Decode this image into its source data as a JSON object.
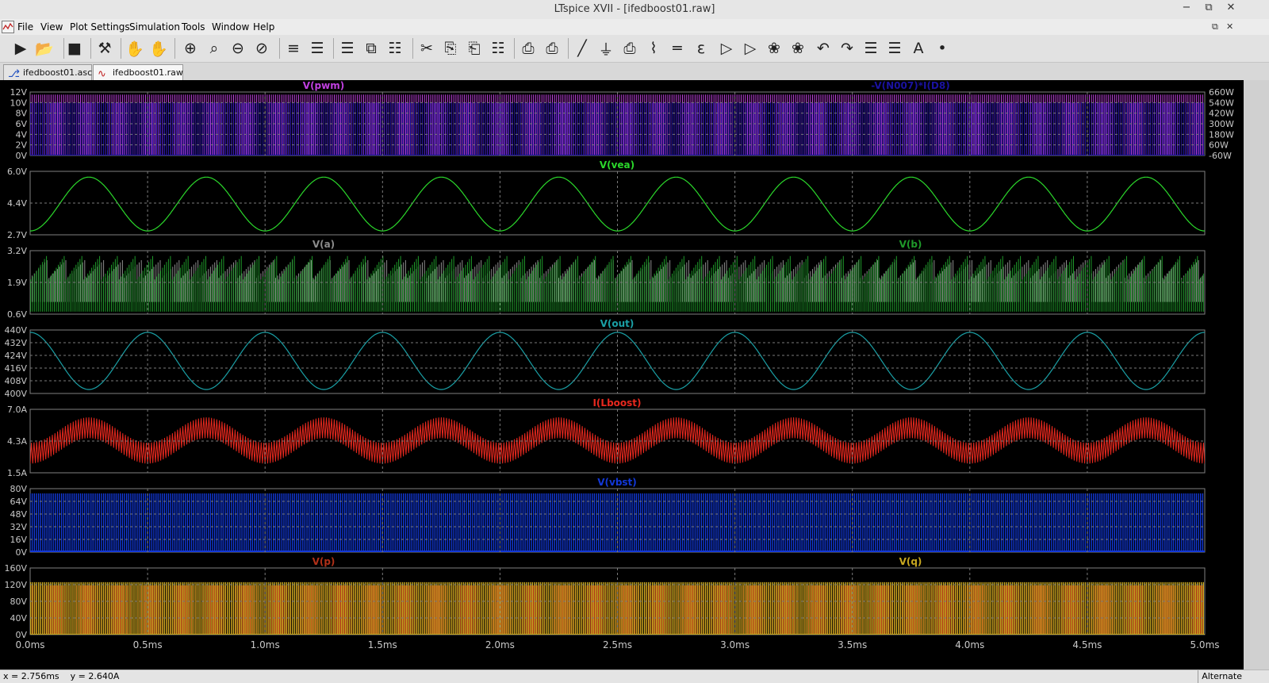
{
  "window": {
    "title": "LTspice XVII - [ifedboost01.raw]"
  },
  "menu": [
    "File",
    "View",
    "Plot Settings",
    "Simulation",
    "Tools",
    "Window",
    "Help"
  ],
  "toolbar_icons": [
    "run-icon",
    "open-icon",
    "save-icon",
    "control-panel-icon",
    "halt-icon",
    "pan-hand-icon",
    "zoom-in-icon",
    "zoom-area-icon",
    "zoom-out-icon",
    "zoom-cancel-icon",
    "autorange-icon",
    "pick-visible-icon",
    "tile-horizontal-icon",
    "cascade-icon",
    "tile-vertical-icon",
    "cut-icon",
    "copy-icon",
    "paste-icon",
    "find-icon",
    "print-preview-icon",
    "print-icon",
    "wire-icon",
    "ground-icon",
    "label-net-icon",
    "resistor-icon",
    "capacitor-icon",
    "inductor-icon",
    "diode-icon",
    "component-icon",
    "rotate-icon",
    "mirror-icon",
    "undo-icon",
    "redo-icon",
    "move-icon",
    "drag-icon",
    "text-icon",
    "spice-directive-icon"
  ],
  "tabs": [
    {
      "label": "ifedboost01.asc",
      "icon": "schematic-icon",
      "active": false
    },
    {
      "label": "ifedboost01.raw",
      "icon": "waveform-icon",
      "active": true
    }
  ],
  "statusbar": {
    "cursor_x": "x = 2.756ms",
    "cursor_y": "y = 2.640A",
    "mode": "Alternate"
  },
  "colors": {
    "plot_bg": "#000000",
    "axis": "#808080",
    "grid": "#7a7a7a"
  },
  "chart_data": {
    "type": "line",
    "xlabel_ticks": [
      "0.0ms",
      "0.5ms",
      "1.0ms",
      "1.5ms",
      "2.0ms",
      "2.5ms",
      "3.0ms",
      "3.5ms",
      "4.0ms",
      "4.5ms",
      "5.0ms"
    ],
    "xlim": [
      0,
      5
    ],
    "x_unit": "ms",
    "panes": [
      {
        "id": "pwm",
        "left_ticks": [
          "12V",
          "10V",
          "8V",
          "6V",
          "4V",
          "2V",
          "0V"
        ],
        "right_ticks": [
          "660W",
          "540W",
          "420W",
          "300W",
          "180W",
          "60W",
          "-60W"
        ],
        "ylim": [
          0,
          12
        ],
        "y2lim": [
          -60,
          660
        ],
        "series": [
          {
            "name": "V(pwm)",
            "color": "#c040e0",
            "label_pos": "left",
            "kind": "pwm",
            "low": 0,
            "high": 11.5
          },
          {
            "name": "-V(N007)*I(D8)",
            "color": "#1a12a0",
            "label_pos": "right",
            "kind": "power",
            "low": -60,
            "high": 540
          }
        ]
      },
      {
        "id": "vea",
        "left_ticks": [
          "6.0V",
          "4.4V",
          "2.7V"
        ],
        "ylim": [
          2.7,
          6.0
        ],
        "series": [
          {
            "name": "V(vea)",
            "color": "#2bd82b",
            "label_pos": "center",
            "kind": "sine",
            "offset": 4.3,
            "amplitude": 1.4,
            "period_ms": 0.5,
            "phase_deg": -90
          }
        ]
      },
      {
        "id": "ab",
        "left_ticks": [
          "3.2V",
          "1.9V",
          "0.6V"
        ],
        "ylim": [
          0.6,
          3.2
        ],
        "series": [
          {
            "name": "V(a)",
            "color": "#8c8c8c",
            "label_pos": "left",
            "kind": "ramp",
            "low": 1.1,
            "high": 2.9
          },
          {
            "name": "V(b)",
            "color": "#1f9a2a",
            "label_pos": "right",
            "kind": "ramp",
            "low": 0.7,
            "high": 3.1
          }
        ]
      },
      {
        "id": "out",
        "left_ticks": [
          "440V",
          "432V",
          "424V",
          "416V",
          "408V",
          "400V"
        ],
        "ylim": [
          400,
          440
        ],
        "series": [
          {
            "name": "V(out)",
            "color": "#1aa0a6",
            "label_pos": "center",
            "kind": "sine",
            "offset": 420.5,
            "amplitude": 18,
            "period_ms": 0.5,
            "phase_deg": 90
          }
        ]
      },
      {
        "id": "lboost",
        "left_ticks": [
          "7.0A",
          "4.3A",
          "1.5A"
        ],
        "ylim": [
          1.5,
          7.0
        ],
        "series": [
          {
            "name": "I(Lboost)",
            "color": "#e8281e",
            "label_pos": "center",
            "kind": "sine_ripple",
            "offset": 4.3,
            "amplitude": 1.1,
            "ripple": 0.9,
            "period_ms": 0.5,
            "phase_deg": -90
          }
        ]
      },
      {
        "id": "vbst",
        "left_ticks": [
          "80V",
          "64V",
          "48V",
          "32V",
          "16V",
          "0V"
        ],
        "ylim": [
          0,
          80
        ],
        "series": [
          {
            "name": "V(vbst)",
            "color": "#1238d8",
            "label_pos": "center",
            "kind": "switch",
            "low": 1,
            "high": 74
          }
        ]
      },
      {
        "id": "pq",
        "left_ticks": [
          "160V",
          "120V",
          "80V",
          "40V",
          "0V"
        ],
        "ylim": [
          0,
          160
        ],
        "series": [
          {
            "name": "V(p)",
            "color": "#b03018",
            "label_pos": "left",
            "kind": "switch",
            "low": 0,
            "high": 118
          },
          {
            "name": "V(q)",
            "color": "#c8a820",
            "label_pos": "right",
            "kind": "switch",
            "low": 0,
            "high": 126
          }
        ]
      }
    ]
  }
}
